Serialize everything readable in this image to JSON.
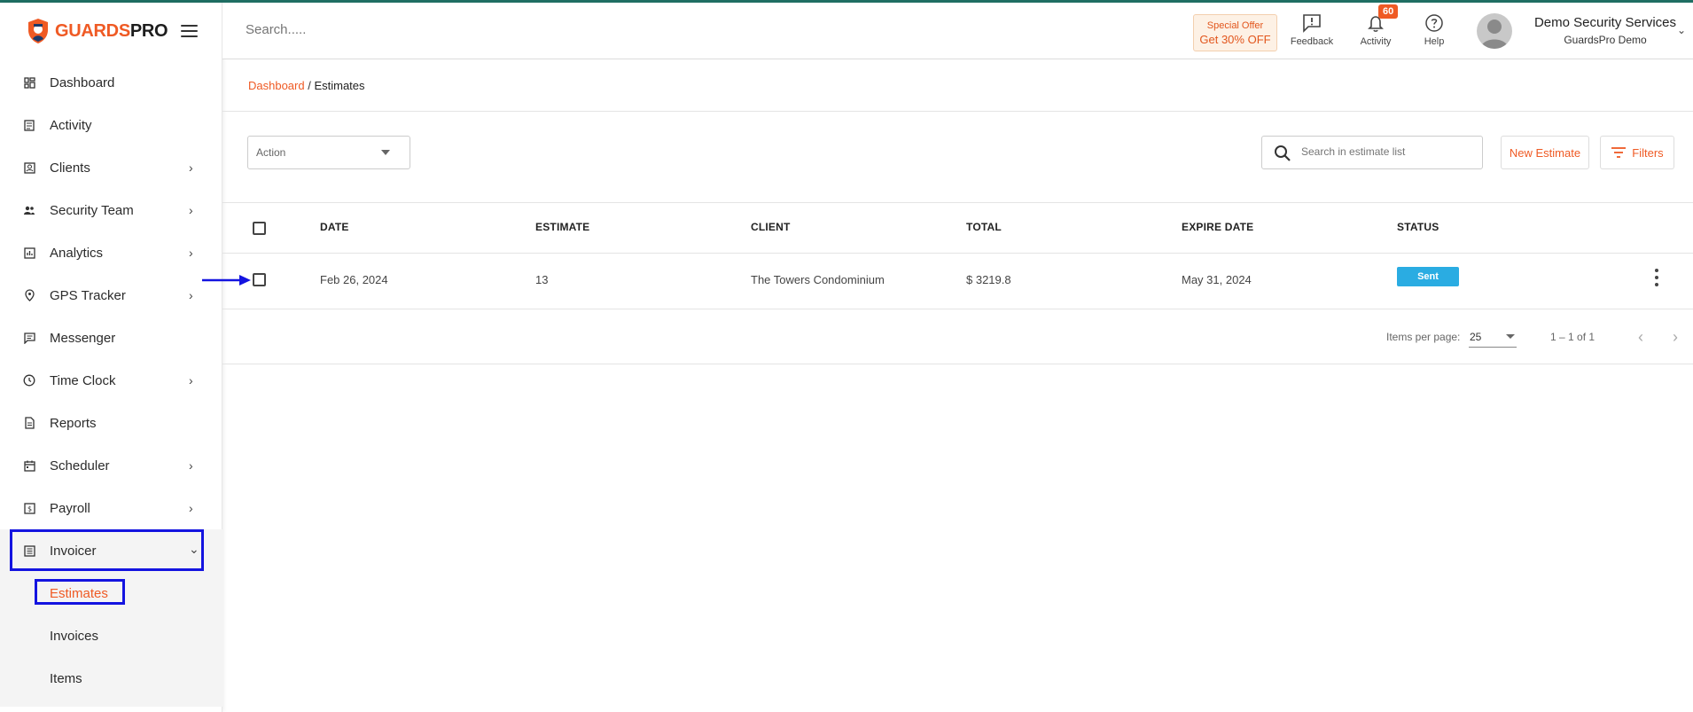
{
  "brand": {
    "part1": "GUARDS",
    "part2": "PRO"
  },
  "colors": {
    "accent": "#ef5a24",
    "status_sent": "#2aace2",
    "highlight": "#1414e0",
    "topline": "#1f6e63"
  },
  "header": {
    "search_placeholder": "Search.....",
    "offer_line1": "Special Offer",
    "offer_line2": "Get 30% OFF",
    "feedback": "Feedback",
    "activity": "Activity",
    "activity_badge": "60",
    "help": "Help",
    "user_name": "Demo Security Services",
    "user_org": "GuardsPro Demo"
  },
  "sidebar": {
    "items": [
      {
        "label": "Dashboard",
        "icon": "dashboard-icon",
        "chevron": ""
      },
      {
        "label": "Activity",
        "icon": "activity-icon",
        "chevron": ""
      },
      {
        "label": "Clients",
        "icon": "clients-icon",
        "chevron": "›"
      },
      {
        "label": "Security Team",
        "icon": "team-icon",
        "chevron": "›"
      },
      {
        "label": "Analytics",
        "icon": "analytics-icon",
        "chevron": "›"
      },
      {
        "label": "GPS Tracker",
        "icon": "location-pin-icon",
        "chevron": "›"
      },
      {
        "label": "Messenger",
        "icon": "message-icon",
        "chevron": ""
      },
      {
        "label": "Time Clock",
        "icon": "clock-icon",
        "chevron": "›"
      },
      {
        "label": "Reports",
        "icon": "report-icon",
        "chevron": ""
      },
      {
        "label": "Scheduler",
        "icon": "calendar-icon",
        "chevron": "›"
      },
      {
        "label": "Payroll",
        "icon": "payroll-icon",
        "chevron": "›"
      },
      {
        "label": "Invoicer",
        "icon": "invoice-icon",
        "chevron": "⌄"
      }
    ],
    "sub_items": [
      {
        "label": "Estimates"
      },
      {
        "label": "Invoices"
      },
      {
        "label": "Items"
      }
    ]
  },
  "breadcrumb": {
    "root": "Dashboard",
    "sep": " / ",
    "current": "Estimates"
  },
  "toolbar": {
    "action_value": "Action",
    "search_placeholder": "Search in estimate list",
    "new_estimate": "New Estimate",
    "filters": "Filters"
  },
  "table": {
    "headers": [
      "DATE",
      "ESTIMATE",
      "CLIENT",
      "TOTAL",
      "EXPIRE DATE",
      "STATUS"
    ],
    "rows": [
      {
        "date": "Feb 26, 2024",
        "estimate": "13",
        "client": "The Towers Condominium",
        "total": "$ 3219.8",
        "expire": "May 31, 2024",
        "status": "Sent"
      }
    ]
  },
  "pagination": {
    "label": "Items per page:",
    "per_page": "25",
    "range": "1 – 1 of 1"
  }
}
